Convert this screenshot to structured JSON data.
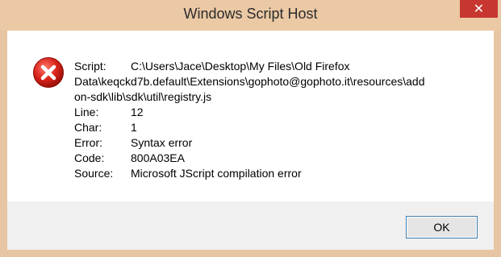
{
  "window": {
    "title": "Windows Script Host",
    "close_glyph": "✕"
  },
  "icon": "error-icon",
  "fields": {
    "script_label": "Script:",
    "script_value_line1": "C:\\Users\\Jace\\Desktop\\My Files\\Old Firefox",
    "script_value_line2": "Data\\keqckd7b.default\\Extensions\\gophoto@gophoto.it\\resources\\add",
    "script_value_line3": "on-sdk\\lib\\sdk\\util\\registry.js",
    "line_label": "Line:",
    "line_value": "12",
    "char_label": "Char:",
    "char_value": "1",
    "error_label": "Error:",
    "error_value": "Syntax error",
    "code_label": "Code:",
    "code_value": "800A03EA",
    "source_label": "Source:",
    "source_value": "Microsoft JScript compilation error"
  },
  "buttons": {
    "ok_label": "OK"
  }
}
